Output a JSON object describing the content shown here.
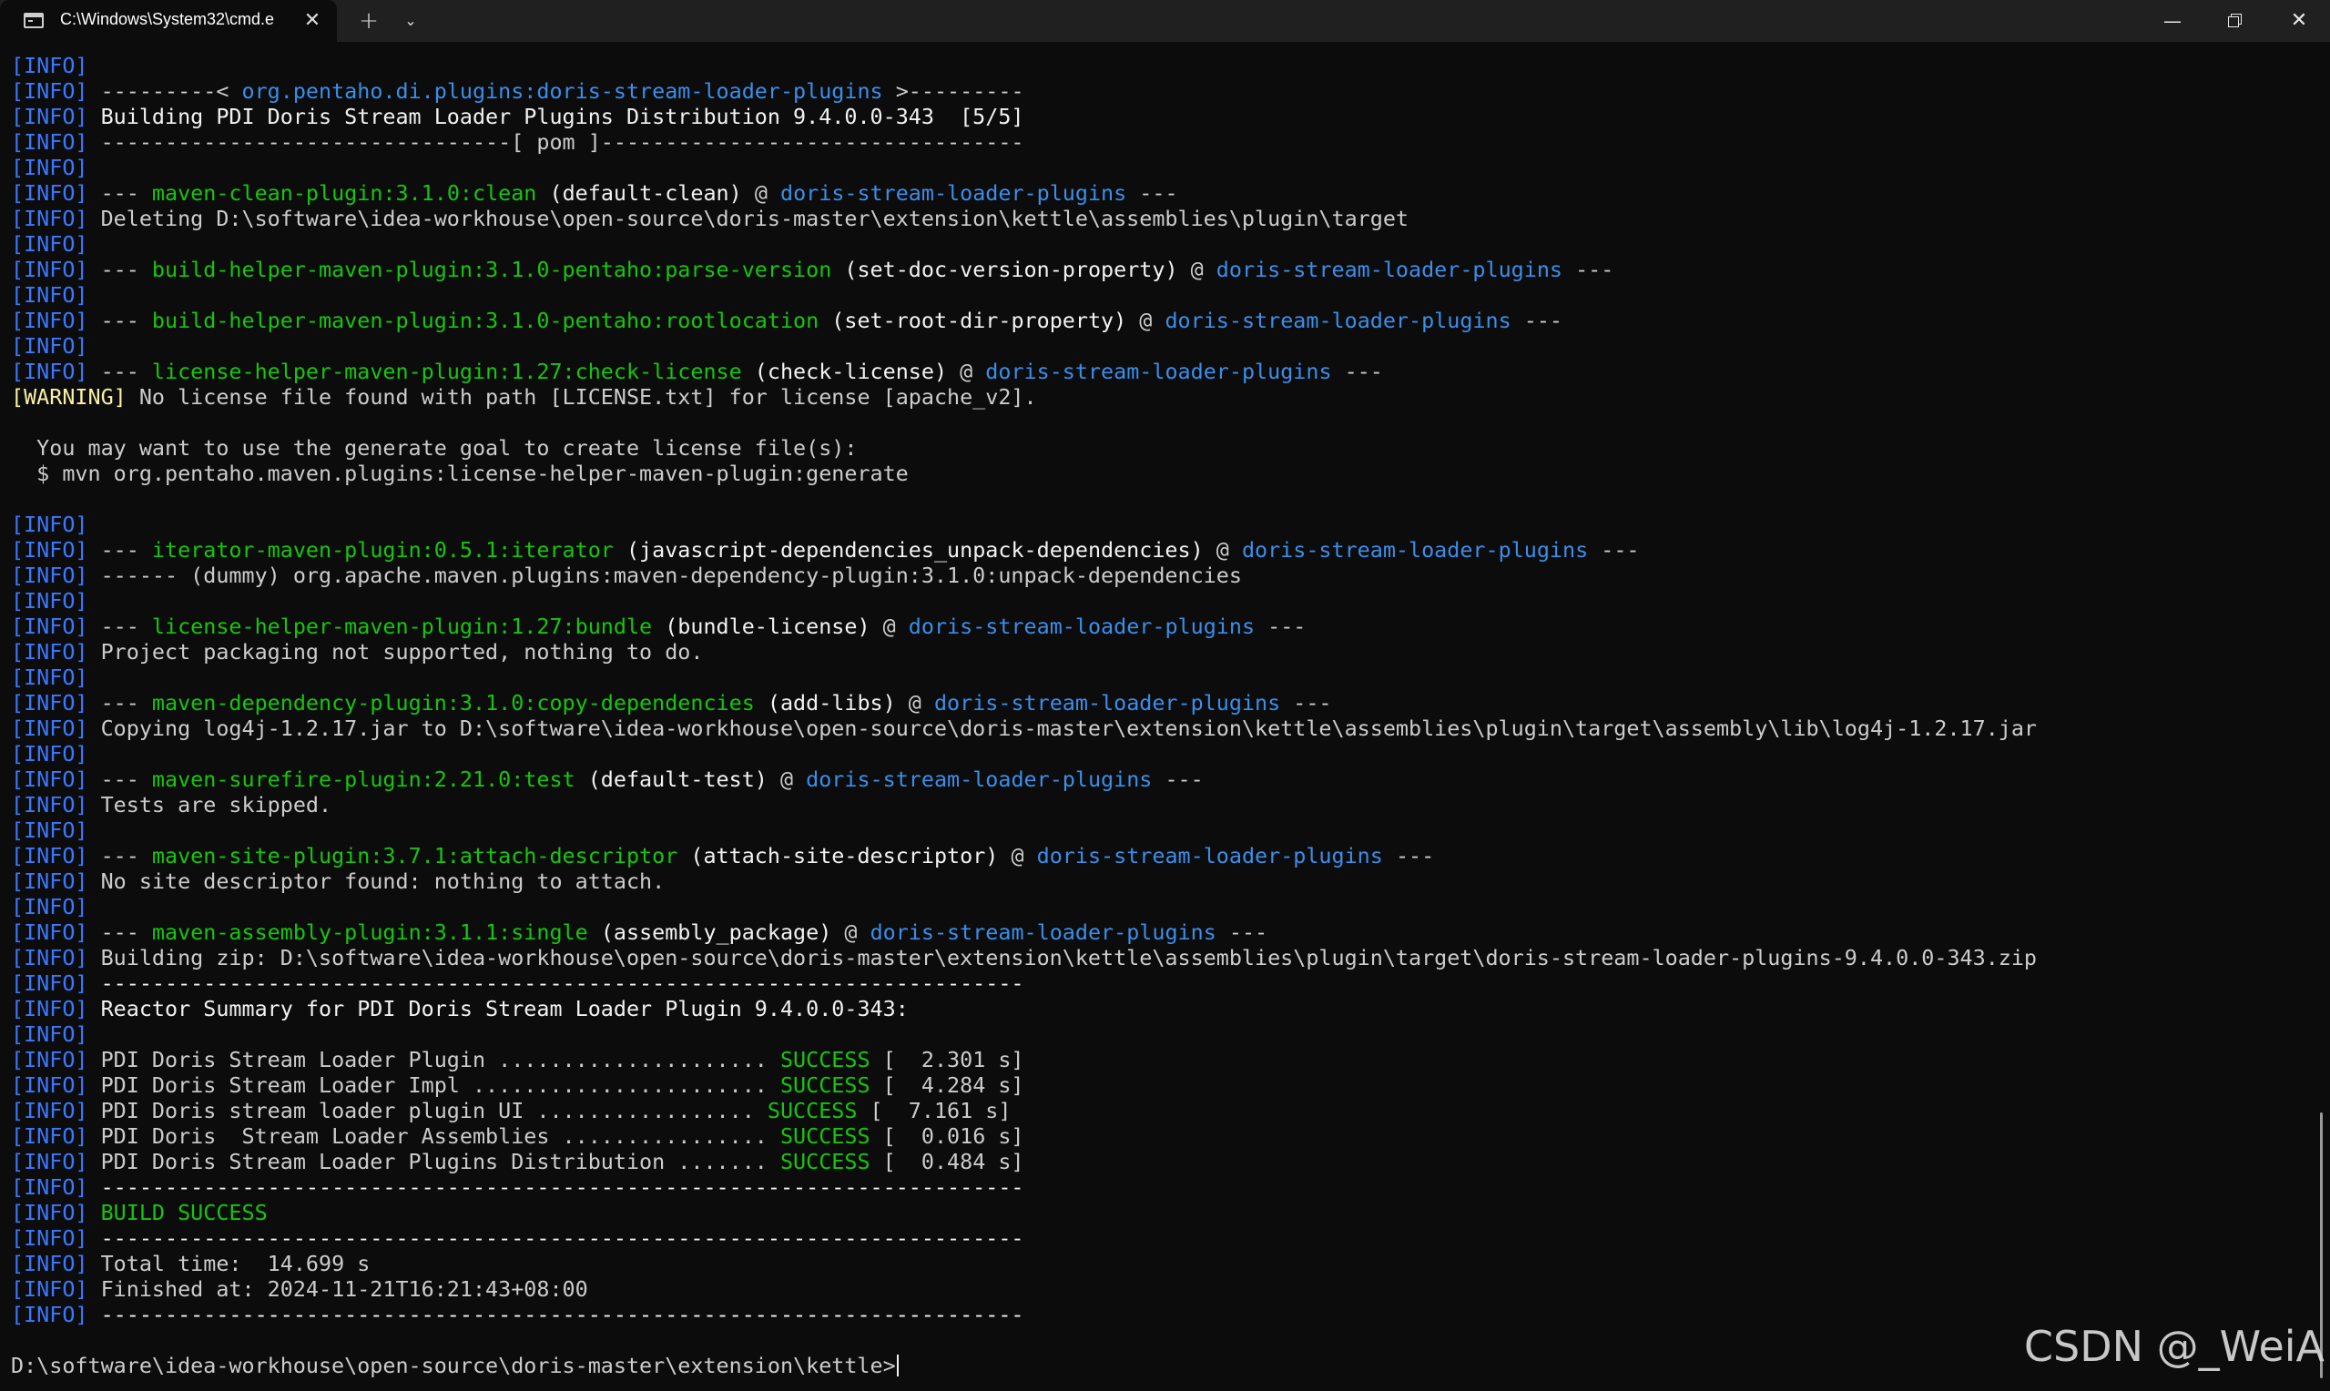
{
  "window": {
    "tab_title": "C:\\Windows\\System32\\cmd.e",
    "tab_close": "✕",
    "new_tab": "+",
    "dropdown": "⌄",
    "minimize": "—",
    "close": "✕"
  },
  "colors": {
    "info_tag": "#3b78ff",
    "warning_tag": "#f9f1a5",
    "plugin_goal": "#16c60c",
    "artifact": "#3b8eea",
    "success": "#16c60c"
  },
  "lines": [
    [
      {
        "t": "[INFO]",
        "c": "tag-info"
      }
    ],
    [
      {
        "t": "[INFO]",
        "c": "tag-info"
      },
      {
        "t": " ---------< "
      },
      {
        "t": "org.pentaho.di.plugins:doris-stream-loader-plugins",
        "c": "artifact"
      },
      {
        "t": " >---------"
      }
    ],
    [
      {
        "t": "[INFO]",
        "c": "tag-info"
      },
      {
        "t": " Building PDI Doris Stream Loader Plugins Distribution 9.4.0.0-343  [5/5]",
        "c": "bold"
      }
    ],
    [
      {
        "t": "[INFO]",
        "c": "tag-info"
      },
      {
        "t": " --------------------------------[ pom ]---------------------------------"
      }
    ],
    [
      {
        "t": "[INFO]",
        "c": "tag-info"
      }
    ],
    [
      {
        "t": "[INFO]",
        "c": "tag-info"
      },
      {
        "t": " --- "
      },
      {
        "t": "maven-clean-plugin:3.1.0:clean",
        "c": "plugin"
      },
      {
        "t": " (default-clean)",
        "c": "bold"
      },
      {
        "t": " @ "
      },
      {
        "t": "doris-stream-loader-plugins",
        "c": "artifact"
      },
      {
        "t": " ---"
      }
    ],
    [
      {
        "t": "[INFO]",
        "c": "tag-info"
      },
      {
        "t": " Deleting D:\\software\\idea-workhouse\\open-source\\doris-master\\extension\\kettle\\assemblies\\plugin\\target"
      }
    ],
    [
      {
        "t": "[INFO]",
        "c": "tag-info"
      }
    ],
    [
      {
        "t": "[INFO]",
        "c": "tag-info"
      },
      {
        "t": " --- "
      },
      {
        "t": "build-helper-maven-plugin:3.1.0-pentaho:parse-version",
        "c": "plugin"
      },
      {
        "t": " (set-doc-version-property)",
        "c": "bold"
      },
      {
        "t": " @ "
      },
      {
        "t": "doris-stream-loader-plugins",
        "c": "artifact"
      },
      {
        "t": " ---"
      }
    ],
    [
      {
        "t": "[INFO]",
        "c": "tag-info"
      }
    ],
    [
      {
        "t": "[INFO]",
        "c": "tag-info"
      },
      {
        "t": " --- "
      },
      {
        "t": "build-helper-maven-plugin:3.1.0-pentaho:rootlocation",
        "c": "plugin"
      },
      {
        "t": " (set-root-dir-property)",
        "c": "bold"
      },
      {
        "t": " @ "
      },
      {
        "t": "doris-stream-loader-plugins",
        "c": "artifact"
      },
      {
        "t": " ---"
      }
    ],
    [
      {
        "t": "[INFO]",
        "c": "tag-info"
      }
    ],
    [
      {
        "t": "[INFO]",
        "c": "tag-info"
      },
      {
        "t": " --- "
      },
      {
        "t": "license-helper-maven-plugin:1.27:check-license",
        "c": "plugin"
      },
      {
        "t": " (check-license)",
        "c": "bold"
      },
      {
        "t": " @ "
      },
      {
        "t": "doris-stream-loader-plugins",
        "c": "artifact"
      },
      {
        "t": " ---"
      }
    ],
    [
      {
        "t": "[WARNING]",
        "c": "tag-warn"
      },
      {
        "t": " No license file found with path [LICENSE.txt] for license [apache_v2]."
      }
    ],
    [
      {
        "t": ""
      }
    ],
    [
      {
        "t": "  You may want to use the generate goal to create license file(s):"
      }
    ],
    [
      {
        "t": "  $ mvn org.pentaho.maven.plugins:license-helper-maven-plugin:generate"
      }
    ],
    [
      {
        "t": ""
      }
    ],
    [
      {
        "t": "[INFO]",
        "c": "tag-info"
      }
    ],
    [
      {
        "t": "[INFO]",
        "c": "tag-info"
      },
      {
        "t": " --- "
      },
      {
        "t": "iterator-maven-plugin:0.5.1:iterator",
        "c": "plugin"
      },
      {
        "t": " (javascript-dependencies_unpack-dependencies)",
        "c": "bold"
      },
      {
        "t": " @ "
      },
      {
        "t": "doris-stream-loader-plugins",
        "c": "artifact"
      },
      {
        "t": " ---"
      }
    ],
    [
      {
        "t": "[INFO]",
        "c": "tag-info"
      },
      {
        "t": " ------ (dummy) org.apache.maven.plugins:maven-dependency-plugin:3.1.0:unpack-dependencies"
      }
    ],
    [
      {
        "t": "[INFO]",
        "c": "tag-info"
      }
    ],
    [
      {
        "t": "[INFO]",
        "c": "tag-info"
      },
      {
        "t": " --- "
      },
      {
        "t": "license-helper-maven-plugin:1.27:bundle",
        "c": "plugin"
      },
      {
        "t": " (bundle-license)",
        "c": "bold"
      },
      {
        "t": " @ "
      },
      {
        "t": "doris-stream-loader-plugins",
        "c": "artifact"
      },
      {
        "t": " ---"
      }
    ],
    [
      {
        "t": "[INFO]",
        "c": "tag-info"
      },
      {
        "t": " Project packaging not supported, nothing to do."
      }
    ],
    [
      {
        "t": "[INFO]",
        "c": "tag-info"
      }
    ],
    [
      {
        "t": "[INFO]",
        "c": "tag-info"
      },
      {
        "t": " --- "
      },
      {
        "t": "maven-dependency-plugin:3.1.0:copy-dependencies",
        "c": "plugin"
      },
      {
        "t": " (add-libs)",
        "c": "bold"
      },
      {
        "t": " @ "
      },
      {
        "t": "doris-stream-loader-plugins",
        "c": "artifact"
      },
      {
        "t": " ---"
      }
    ],
    [
      {
        "t": "[INFO]",
        "c": "tag-info"
      },
      {
        "t": " Copying log4j-1.2.17.jar to D:\\software\\idea-workhouse\\open-source\\doris-master\\extension\\kettle\\assemblies\\plugin\\target\\assembly\\lib\\log4j-1.2.17.jar"
      }
    ],
    [
      {
        "t": "[INFO]",
        "c": "tag-info"
      }
    ],
    [
      {
        "t": "[INFO]",
        "c": "tag-info"
      },
      {
        "t": " --- "
      },
      {
        "t": "maven-surefire-plugin:2.21.0:test",
        "c": "plugin"
      },
      {
        "t": " (default-test)",
        "c": "bold"
      },
      {
        "t": " @ "
      },
      {
        "t": "doris-stream-loader-plugins",
        "c": "artifact"
      },
      {
        "t": " ---"
      }
    ],
    [
      {
        "t": "[INFO]",
        "c": "tag-info"
      },
      {
        "t": " Tests are skipped."
      }
    ],
    [
      {
        "t": "[INFO]",
        "c": "tag-info"
      }
    ],
    [
      {
        "t": "[INFO]",
        "c": "tag-info"
      },
      {
        "t": " --- "
      },
      {
        "t": "maven-site-plugin:3.7.1:attach-descriptor",
        "c": "plugin"
      },
      {
        "t": " (attach-site-descriptor)",
        "c": "bold"
      },
      {
        "t": " @ "
      },
      {
        "t": "doris-stream-loader-plugins",
        "c": "artifact"
      },
      {
        "t": " ---"
      }
    ],
    [
      {
        "t": "[INFO]",
        "c": "tag-info"
      },
      {
        "t": " No site descriptor found: nothing to attach."
      }
    ],
    [
      {
        "t": "[INFO]",
        "c": "tag-info"
      }
    ],
    [
      {
        "t": "[INFO]",
        "c": "tag-info"
      },
      {
        "t": " --- "
      },
      {
        "t": "maven-assembly-plugin:3.1.1:single",
        "c": "plugin"
      },
      {
        "t": " (assembly_package)",
        "c": "bold"
      },
      {
        "t": " @ "
      },
      {
        "t": "doris-stream-loader-plugins",
        "c": "artifact"
      },
      {
        "t": " ---"
      }
    ],
    [
      {
        "t": "[INFO]",
        "c": "tag-info"
      },
      {
        "t": " Building zip: D:\\software\\idea-workhouse\\open-source\\doris-master\\extension\\kettle\\assemblies\\plugin\\target\\doris-stream-loader-plugins-9.4.0.0-343.zip"
      }
    ],
    [
      {
        "t": "[INFO]",
        "c": "tag-info"
      },
      {
        "t": " ------------------------------------------------------------------------",
        "c": "bold"
      }
    ],
    [
      {
        "t": "[INFO]",
        "c": "tag-info"
      },
      {
        "t": " Reactor Summary for PDI Doris Stream Loader Plugin 9.4.0.0-343:",
        "c": "bold"
      }
    ],
    [
      {
        "t": "[INFO]",
        "c": "tag-info"
      }
    ],
    [
      {
        "t": "[INFO]",
        "c": "tag-info"
      },
      {
        "t": " PDI Doris Stream Loader Plugin ..................... "
      },
      {
        "t": "SUCCESS",
        "c": "success"
      },
      {
        "t": " [  2.301 s]"
      }
    ],
    [
      {
        "t": "[INFO]",
        "c": "tag-info"
      },
      {
        "t": " PDI Doris Stream Loader Impl ....................... "
      },
      {
        "t": "SUCCESS",
        "c": "success"
      },
      {
        "t": " [  4.284 s]"
      }
    ],
    [
      {
        "t": "[INFO]",
        "c": "tag-info"
      },
      {
        "t": " PDI Doris stream loader plugin UI ................. "
      },
      {
        "t": "SUCCESS",
        "c": "success"
      },
      {
        "t": " [  7.161 s]"
      }
    ],
    [
      {
        "t": "[INFO]",
        "c": "tag-info"
      },
      {
        "t": " PDI Doris  Stream Loader Assemblies ................ "
      },
      {
        "t": "SUCCESS",
        "c": "success"
      },
      {
        "t": " [  0.016 s]"
      }
    ],
    [
      {
        "t": "[INFO]",
        "c": "tag-info"
      },
      {
        "t": " PDI Doris Stream Loader Plugins Distribution ....... "
      },
      {
        "t": "SUCCESS",
        "c": "success"
      },
      {
        "t": " [  0.484 s]"
      }
    ],
    [
      {
        "t": "[INFO]",
        "c": "tag-info"
      },
      {
        "t": " ------------------------------------------------------------------------",
        "c": "bold"
      }
    ],
    [
      {
        "t": "[INFO]",
        "c": "tag-info"
      },
      {
        "t": " BUILD SUCCESS",
        "c": "buildok"
      }
    ],
    [
      {
        "t": "[INFO]",
        "c": "tag-info"
      },
      {
        "t": " ------------------------------------------------------------------------",
        "c": "bold"
      }
    ],
    [
      {
        "t": "[INFO]",
        "c": "tag-info"
      },
      {
        "t": " Total time:  14.699 s"
      }
    ],
    [
      {
        "t": "[INFO]",
        "c": "tag-info"
      },
      {
        "t": " Finished at: 2024-11-21T16:21:43+08:00"
      }
    ],
    [
      {
        "t": "[INFO]",
        "c": "tag-info"
      },
      {
        "t": " ------------------------------------------------------------------------",
        "c": "bold"
      }
    ],
    [
      {
        "t": ""
      }
    ],
    [
      {
        "t": "D:\\software\\idea-workhouse\\open-source\\doris-master\\extension\\kettle>"
      }
    ]
  ],
  "watermark": "CSDN @_WeiA"
}
